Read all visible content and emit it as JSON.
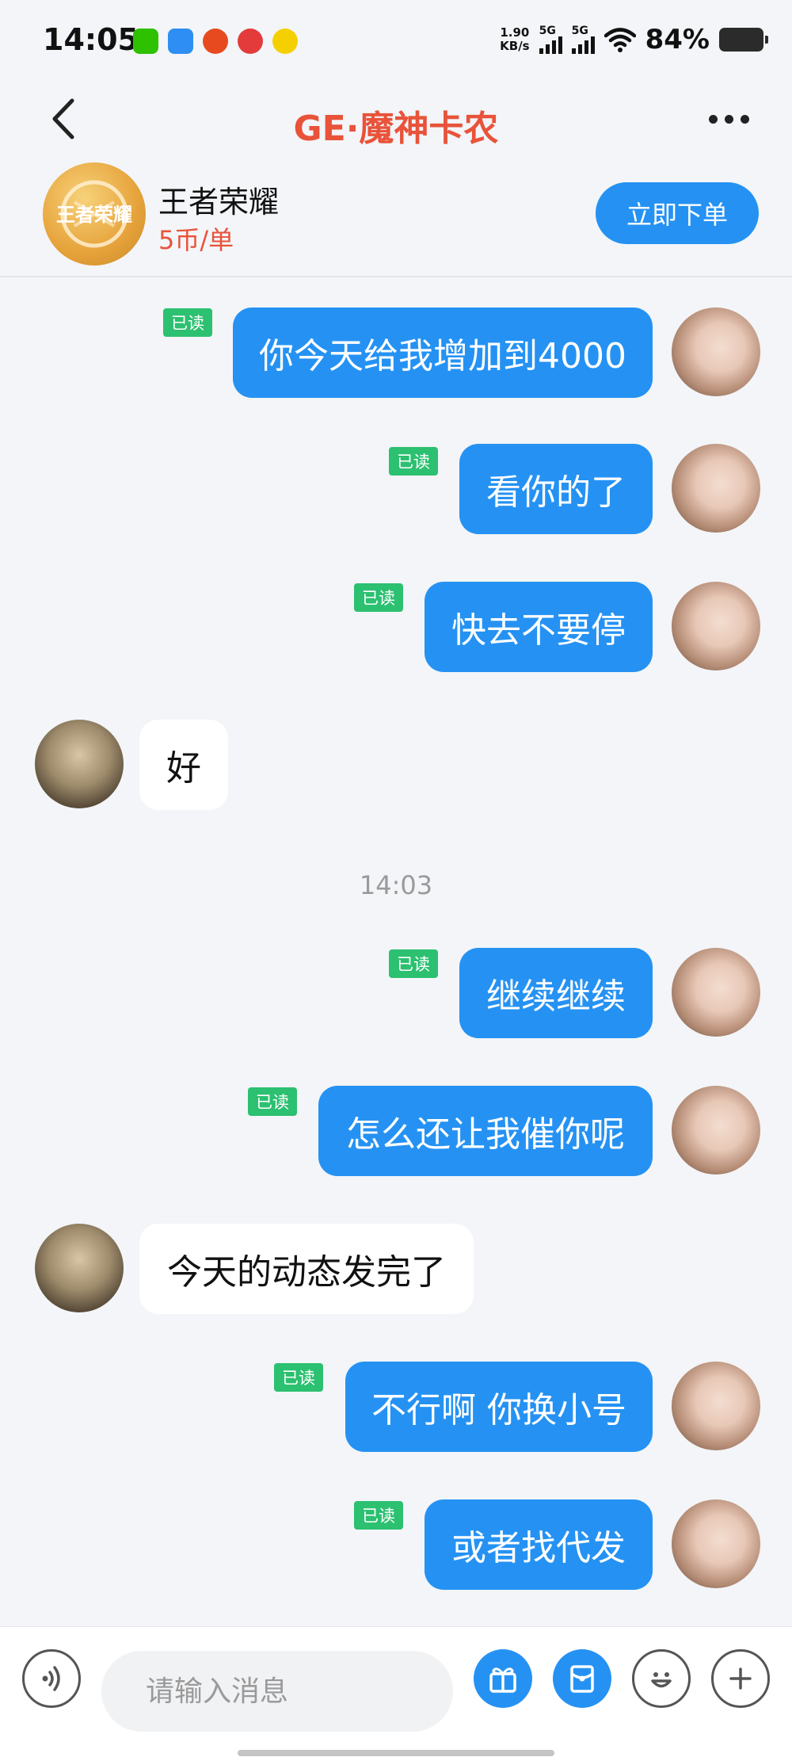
{
  "status_bar": {
    "time": "14:05",
    "net_speed_value": "1.90",
    "net_speed_unit": "KB/s",
    "signal1_label": "5G",
    "signal2_label": "5G",
    "battery_percent": "84%",
    "app_icons": [
      "wechat-icon",
      "app-blue-icon",
      "app-orange-icon",
      "netease-music-icon",
      "qq-music-icon"
    ],
    "colors": {
      "wechat": "#2dc100",
      "blue_app": "#2f8ef4",
      "orange_app": "#e84a1f",
      "netease": "#e33b3b",
      "qq_music": "#f5d000"
    }
  },
  "header": {
    "title": "GE·魔神卡农"
  },
  "order_card": {
    "game_name": "王者荣耀",
    "price": "5币/单",
    "order_button": "立即下单",
    "logo_text": "王者荣耀"
  },
  "messages": [
    {
      "id": "m1",
      "direction": "out",
      "text": "你今天给我增加到4000",
      "read_label": "已读"
    },
    {
      "id": "m2",
      "direction": "out",
      "text": "看你的了",
      "read_label": "已读"
    },
    {
      "id": "m3",
      "direction": "out",
      "text": "快去不要停",
      "read_label": "已读"
    },
    {
      "id": "m4",
      "direction": "in",
      "text": "好"
    },
    {
      "id": "ts1",
      "type": "timestamp",
      "text": "14:03"
    },
    {
      "id": "m5",
      "direction": "out",
      "text": "继续继续",
      "read_label": "已读"
    },
    {
      "id": "m6",
      "direction": "out",
      "text": "怎么还让我催你呢",
      "read_label": "已读"
    },
    {
      "id": "m7",
      "direction": "in",
      "text": "今天的动态发完了"
    },
    {
      "id": "m8",
      "direction": "out",
      "text": "不行啊 你换小号",
      "read_label": "已读"
    },
    {
      "id": "m9",
      "direction": "out",
      "text": "或者找代发",
      "read_label": "已读"
    }
  ],
  "input_bar": {
    "placeholder": "请输入消息",
    "icons": [
      "voice-icon",
      "gift-icon",
      "red-packet-icon",
      "emoji-icon",
      "plus-icon"
    ]
  },
  "colors": {
    "accent": "#2592f3",
    "title": "#e8533a",
    "read_badge": "#2cc071",
    "background": "#f3f5f8"
  }
}
